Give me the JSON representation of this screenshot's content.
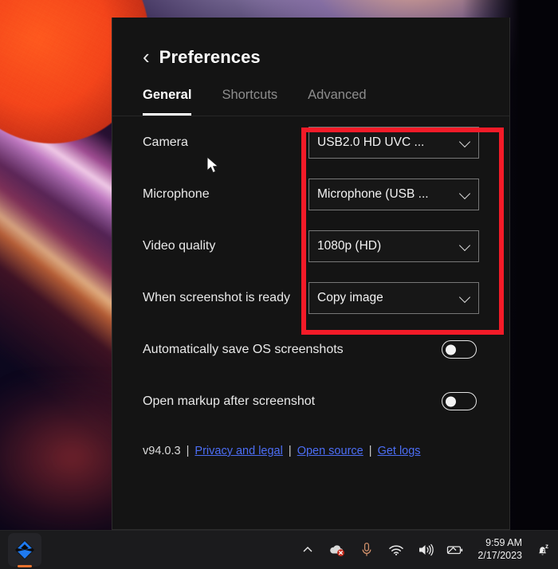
{
  "window": {
    "title": "Preferences",
    "back_icon": "chevron-left-icon"
  },
  "tabs": [
    {
      "label": "General",
      "active": true
    },
    {
      "label": "Shortcuts",
      "active": false
    },
    {
      "label": "Advanced",
      "active": false
    }
  ],
  "settings": {
    "rows": [
      {
        "label": "Camera",
        "value": "USB2.0 HD UVC ...",
        "control": "select"
      },
      {
        "label": "Microphone",
        "value": "Microphone (USB ...",
        "control": "select"
      },
      {
        "label": "Video quality",
        "value": "1080p (HD)",
        "control": "select"
      },
      {
        "label": "When screenshot is ready",
        "value": "Copy image",
        "control": "select"
      }
    ],
    "toggles": [
      {
        "label": "Automatically save OS screenshots",
        "state": "off"
      },
      {
        "label": "Open markup after screenshot",
        "state": "off"
      }
    ]
  },
  "footer": {
    "version": "v94.0.3",
    "separator": "|",
    "links": [
      {
        "label": "Privacy and legal"
      },
      {
        "label": "Open source"
      },
      {
        "label": "Get logs"
      }
    ]
  },
  "annotation": {
    "highlight_color": "#f31b28"
  },
  "taskbar": {
    "app_icon": "app-diamond-icon",
    "tray": [
      {
        "icon": "chevron-up-icon",
        "name": "show-hidden-icons"
      },
      {
        "icon": "onedrive-error-icon",
        "name": "onedrive-status"
      },
      {
        "icon": "microphone-icon",
        "name": "microphone-status"
      },
      {
        "icon": "wifi-icon",
        "name": "network-status"
      },
      {
        "icon": "speaker-icon",
        "name": "volume-status"
      },
      {
        "icon": "battery-icon",
        "name": "battery-status"
      }
    ],
    "clock": {
      "time": "9:59 AM",
      "date": "2/17/2023"
    },
    "notifications_icon": "bell-do-not-disturb-icon"
  }
}
